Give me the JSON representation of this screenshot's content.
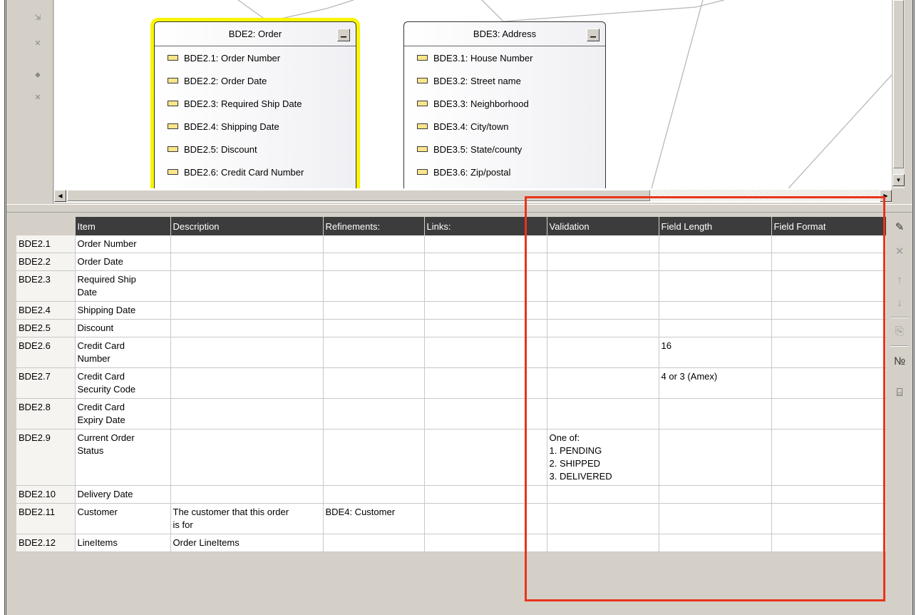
{
  "colors": {
    "highlight": "#e8341c",
    "selected_outline": "#f6f600",
    "header_bg": "#3c3c3c",
    "attribute_icon": "#fbe58a"
  },
  "diagram": {
    "entities": [
      {
        "title": "BDE2: Order",
        "attributes": [
          "BDE2.1: Order Number",
          "BDE2.2: Order Date",
          "BDE2.3: Required Ship Date",
          "BDE2.4: Shipping Date",
          "BDE2.5: Discount",
          "BDE2.6: Credit Card Number"
        ]
      },
      {
        "title": "BDE3: Address",
        "attributes": [
          "BDE3.1: House Number",
          "BDE3.2: Street name",
          "BDE3.3: Neighborhood",
          "BDE3.4: City/town",
          "BDE3.5: State/county",
          "BDE3.6: Zip/postal"
        ]
      }
    ]
  },
  "toolbar_icons": [
    "add-element-icon",
    "delete-element-icon",
    "add-link-icon",
    "delete-link-icon"
  ],
  "right_toolbar_icons": [
    "new-row-icon",
    "delete-row-icon",
    "move-up-icon",
    "move-down-icon",
    "attach-icon",
    "number-icon",
    "properties-icon"
  ],
  "table": {
    "columns": [
      "Item",
      "Description",
      "Refinements:",
      "Links:",
      "Validation",
      "Field Length",
      "Field Format"
    ],
    "rows": [
      {
        "id": "BDE2.1",
        "item": "Order Number",
        "description": "",
        "refinements": "",
        "links": "",
        "validation": "",
        "field_length": "",
        "field_format": ""
      },
      {
        "id": "BDE2.2",
        "item": "Order Date",
        "description": "",
        "refinements": "",
        "links": "",
        "validation": "",
        "field_length": "",
        "field_format": ""
      },
      {
        "id": "BDE2.3",
        "item": "Required Ship\nDate",
        "description": "",
        "refinements": "",
        "links": "",
        "validation": "",
        "field_length": "",
        "field_format": ""
      },
      {
        "id": "BDE2.4",
        "item": "Shipping Date",
        "description": "",
        "refinements": "",
        "links": "",
        "validation": "",
        "field_length": "",
        "field_format": ""
      },
      {
        "id": "BDE2.5",
        "item": "Discount",
        "description": "",
        "refinements": "",
        "links": "",
        "validation": "",
        "field_length": "",
        "field_format": ""
      },
      {
        "id": "BDE2.6",
        "item": "Credit Card\nNumber",
        "description": "",
        "refinements": "",
        "links": "",
        "validation": "",
        "field_length": "16",
        "field_format": ""
      },
      {
        "id": "BDE2.7",
        "item": "Credit Card\nSecurity Code",
        "description": "",
        "refinements": "",
        "links": "",
        "validation": "",
        "field_length": "4 or 3 (Amex)",
        "field_format": ""
      },
      {
        "id": "BDE2.8",
        "item": "Credit Card\nExpiry Date",
        "description": "",
        "refinements": "",
        "links": "",
        "validation": "",
        "field_length": "",
        "field_format": ""
      },
      {
        "id": "BDE2.9",
        "item": "Current Order\nStatus",
        "description": "",
        "refinements": "",
        "links": "",
        "validation": "One of:\n1. PENDING\n2. SHIPPED\n3. DELIVERED",
        "field_length": "",
        "field_format": ""
      },
      {
        "id": "BDE2.10",
        "item": "Delivery Date",
        "description": "",
        "refinements": "",
        "links": "",
        "validation": "",
        "field_length": "",
        "field_format": ""
      },
      {
        "id": "BDE2.11",
        "item": "Customer",
        "description": "The customer that this order\nis for",
        "refinements": "BDE4: Customer",
        "links": "",
        "validation": "",
        "field_length": "",
        "field_format": ""
      },
      {
        "id": "BDE2.12",
        "item": "LineItems",
        "description": "Order LineItems",
        "refinements": "",
        "links": "",
        "validation": "",
        "field_length": "",
        "field_format": ""
      }
    ]
  }
}
